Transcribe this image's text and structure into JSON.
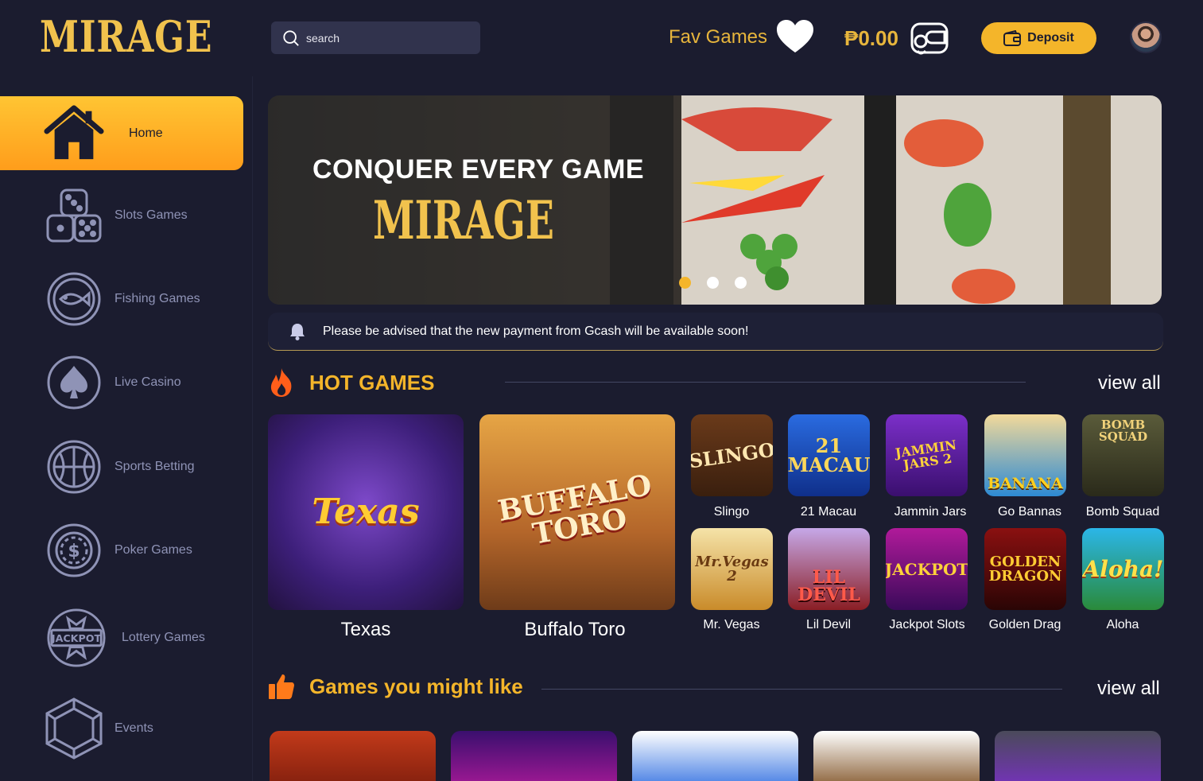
{
  "header": {
    "logo": "MIRAGE",
    "search_placeholder": "search",
    "fav_label": "Fav Games",
    "balance": "₱0.00",
    "deposit_label": "Deposit"
  },
  "sidebar": {
    "items": [
      {
        "label": "Home",
        "icon": "home-icon",
        "active": true
      },
      {
        "label": "Slots Games",
        "icon": "dice-icon"
      },
      {
        "label": "Fishing Games",
        "icon": "fish-icon"
      },
      {
        "label": "Live Casino",
        "icon": "spade-icon"
      },
      {
        "label": "Sports Betting",
        "icon": "basketball-icon"
      },
      {
        "label": "Poker Games",
        "icon": "poker-chip-icon"
      },
      {
        "label": "Lottery Games",
        "icon": "jackpot-icon"
      },
      {
        "label": "Events",
        "icon": "hexagon-gem-icon"
      }
    ]
  },
  "banner": {
    "headline": "CONQUER EVERY GAME",
    "logo": "MIRAGE",
    "active_slide": 1,
    "slides": 3
  },
  "notice": {
    "text": "Please be advised that the new payment from Gcash will be available soon!"
  },
  "hot_games": {
    "title": "HOT GAMES",
    "view_all": "view all",
    "featured": [
      {
        "name": "Texas",
        "art": "Texas"
      },
      {
        "name": "Buffalo Toro",
        "art": "BUFFALO TORO"
      }
    ],
    "grid": [
      {
        "name": "Slingo",
        "art": "SLINGO"
      },
      {
        "name": "21 Macau",
        "art": "21 MACAU"
      },
      {
        "name": "Jammin Jars",
        "art": "JAMMIN JARS 2"
      },
      {
        "name": "Go Bannas",
        "art": "BANANA"
      },
      {
        "name": "Bomb Squad",
        "art": "BOMB SQUAD"
      },
      {
        "name": "Mr. Vegas",
        "art": "Mr.Vegas 2"
      },
      {
        "name": "Lil Devil",
        "art": "LIL DEVIL"
      },
      {
        "name": "Jackpot Slots",
        "art": "JACKPOT"
      },
      {
        "name": "Golden Drag",
        "art": "GOLDEN DRAGON"
      },
      {
        "name": "Aloha",
        "art": "Aloha!"
      }
    ]
  },
  "might_like": {
    "title": "Games you might like",
    "view_all": "view all"
  },
  "colors": {
    "background": "#1b1c2f",
    "accent": "#f4b52a",
    "muted_text": "#8f93b6"
  }
}
